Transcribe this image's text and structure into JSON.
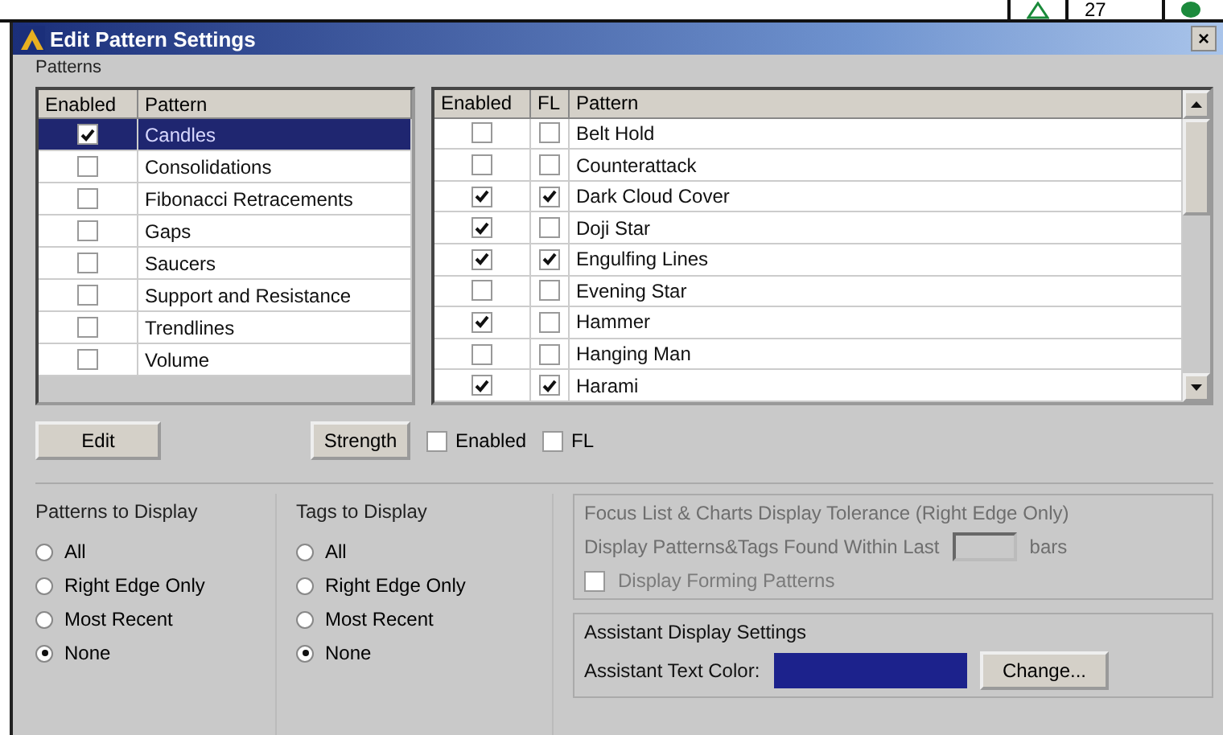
{
  "background_window": {
    "value": "27"
  },
  "window": {
    "title": "Edit Pattern Settings",
    "close": "×"
  },
  "patterns_group": {
    "label": "Patterns"
  },
  "left_table": {
    "columns": [
      "Enabled",
      "Pattern"
    ],
    "rows": [
      {
        "enabled": true,
        "pattern": "Candles",
        "selected": true
      },
      {
        "enabled": false,
        "pattern": "Consolidations",
        "selected": false
      },
      {
        "enabled": false,
        "pattern": "Fibonacci Retracements",
        "selected": false
      },
      {
        "enabled": false,
        "pattern": "Gaps",
        "selected": false
      },
      {
        "enabled": false,
        "pattern": "Saucers",
        "selected": false
      },
      {
        "enabled": false,
        "pattern": "Support and Resistance",
        "selected": false
      },
      {
        "enabled": false,
        "pattern": "Trendlines",
        "selected": false
      },
      {
        "enabled": false,
        "pattern": "Volume",
        "selected": false
      }
    ]
  },
  "right_table": {
    "columns": [
      "Enabled",
      "FL",
      "Pattern"
    ],
    "rows": [
      {
        "enabled": false,
        "fl": false,
        "pattern": "Belt Hold"
      },
      {
        "enabled": false,
        "fl": false,
        "pattern": "Counterattack"
      },
      {
        "enabled": true,
        "fl": true,
        "pattern": "Dark Cloud Cover"
      },
      {
        "enabled": true,
        "fl": false,
        "pattern": "Doji Star"
      },
      {
        "enabled": true,
        "fl": true,
        "pattern": "Engulfing Lines"
      },
      {
        "enabled": false,
        "fl": false,
        "pattern": "Evening Star"
      },
      {
        "enabled": true,
        "fl": false,
        "pattern": "Hammer"
      },
      {
        "enabled": false,
        "fl": false,
        "pattern": "Hanging Man"
      },
      {
        "enabled": true,
        "fl": true,
        "pattern": "Harami"
      }
    ]
  },
  "edit_button": "Edit",
  "strength_button": "Strength",
  "options": [
    {
      "label": "Enabled",
      "checked": false
    },
    {
      "label": "FL",
      "checked": false
    }
  ],
  "patterns_to_display": {
    "title": "Patterns to Display",
    "options": [
      {
        "label": "All",
        "selected": false
      },
      {
        "label": "Right Edge Only",
        "selected": false
      },
      {
        "label": "Most Recent",
        "selected": false
      },
      {
        "label": "None",
        "selected": true
      }
    ]
  },
  "tags_to_display": {
    "title": "Tags to Display",
    "options": [
      {
        "label": "All",
        "selected": false
      },
      {
        "label": "Right Edge Only",
        "selected": false
      },
      {
        "label": "Most Recent",
        "selected": false
      },
      {
        "label": "None",
        "selected": true
      }
    ]
  },
  "tolerance": {
    "title": "Focus List & Charts Display Tolerance (Right Edge Only)",
    "label": "Display Patterns&Tags Found Within Last",
    "unit": "bars",
    "disabled": true,
    "forming": {
      "label": "Display Forming Patterns",
      "checked": false
    }
  },
  "assistant": {
    "title": "Assistant Display Settings",
    "label": "Assistant Text Color:",
    "color": "#1c228c",
    "button": "Change..."
  }
}
